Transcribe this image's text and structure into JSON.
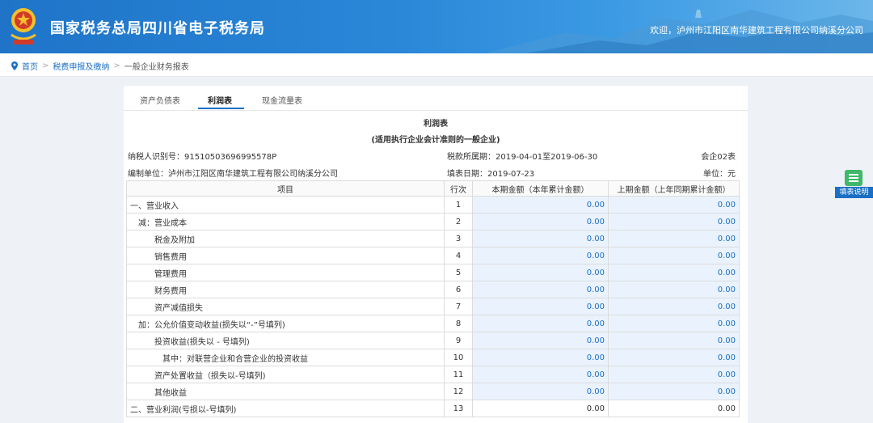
{
  "header": {
    "site_title": "国家税务总局四川省电子税务局",
    "welcome": "欢迎，泸州市江阳区南华建筑工程有限公司纳溪分公司"
  },
  "breadcrumb": {
    "home": "首页",
    "level1": "税费申报及缴纳",
    "level2": "一般企业财务报表"
  },
  "tabs": [
    {
      "label": "资产负债表",
      "active": false
    },
    {
      "label": "利润表",
      "active": true
    },
    {
      "label": "现金流量表",
      "active": false
    }
  ],
  "report": {
    "title": "利润表",
    "subtitle": "(适用执行企业会计准则的一般企业)",
    "taxpayer_id": "纳税人识别号：91510503696995578P",
    "period": "税款所属期：2019-04-01至2019-06-30",
    "form_code": "会企02表",
    "company": "编制单位：泸州市江阳区南华建筑工程有限公司纳溪分公司",
    "fill_date": "填表日期：2019-07-23",
    "unit": "单位：元"
  },
  "table": {
    "headers": [
      "项目",
      "行次",
      "本期金额（本年累计金额）",
      "上期金额（上年同期累计金额）"
    ],
    "rows": [
      {
        "item": "一、营业收入",
        "line": "1",
        "current": "0.00",
        "previous": "0.00"
      },
      {
        "item": "减：营业成本",
        "line": "2",
        "current": "0.00",
        "previous": "0.00"
      },
      {
        "item": "税金及附加",
        "line": "3",
        "current": "0.00",
        "previous": "0.00"
      },
      {
        "item": "销售费用",
        "line": "4",
        "current": "0.00",
        "previous": "0.00"
      },
      {
        "item": "管理费用",
        "line": "5",
        "current": "0.00",
        "previous": "0.00"
      },
      {
        "item": "财务费用",
        "line": "6",
        "current": "0.00",
        "previous": "0.00"
      },
      {
        "item": "资产减值损失",
        "line": "7",
        "current": "0.00",
        "previous": "0.00"
      },
      {
        "item": "加：公允价值变动收益(损失以“-”号填列)",
        "line": "8",
        "current": "0.00",
        "previous": "0.00"
      },
      {
        "item": "投资收益(损失以 - 号填列)",
        "line": "9",
        "current": "0.00",
        "previous": "0.00"
      },
      {
        "item": "其中：对联营企业和合营企业的投资收益",
        "line": "10",
        "current": "0.00",
        "previous": "0.00"
      },
      {
        "item": "资产处置收益（损失以-号填列)",
        "line": "11",
        "current": "0.00",
        "previous": "0.00"
      },
      {
        "item": "其他收益",
        "line": "12",
        "current": "0.00",
        "previous": "0.00"
      },
      {
        "item": "二、营业利润(亏损以-号填列)",
        "line": "13",
        "current": "0.00",
        "previous": "0.00"
      }
    ]
  },
  "side_widget": {
    "label": "填表说明"
  }
}
